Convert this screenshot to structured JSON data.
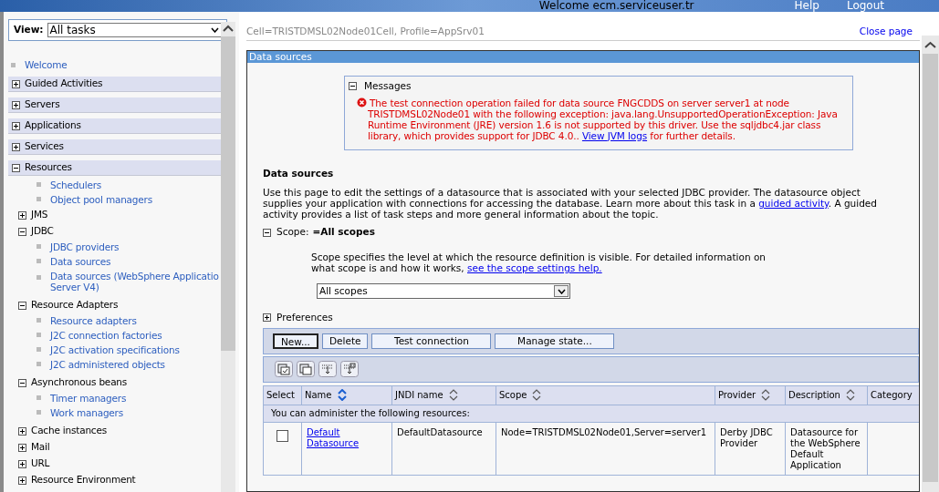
{
  "header": {
    "welcome": "Welcome ecm.serviceuser.tr",
    "links": [
      "Help",
      "Logout"
    ]
  },
  "view": {
    "label": "View:",
    "value": "All tasks"
  },
  "nav": [
    {
      "kind": "link",
      "label": "Welcome"
    },
    {
      "kind": "section",
      "label": "Guided Activities",
      "expanded": false
    },
    {
      "kind": "section",
      "label": "Servers",
      "expanded": false
    },
    {
      "kind": "section",
      "label": "Applications",
      "expanded": false
    },
    {
      "kind": "section",
      "label": "Services",
      "expanded": false
    },
    {
      "kind": "section",
      "label": "Resources",
      "expanded": true,
      "children": [
        {
          "kind": "link",
          "lines": [
            "Schedulers"
          ]
        },
        {
          "kind": "link",
          "lines": [
            "Object pool managers"
          ]
        },
        {
          "kind": "group",
          "label": "JMS",
          "expanded": false
        },
        {
          "kind": "group",
          "label": "JDBC",
          "expanded": true,
          "children": [
            {
              "kind": "link",
              "lines": [
                "JDBC providers"
              ]
            },
            {
              "kind": "link",
              "lines": [
                "Data sources"
              ]
            },
            {
              "kind": "link",
              "lines": [
                "Data sources (WebSphere Applicatio",
                "Server V4)"
              ]
            }
          ]
        },
        {
          "kind": "group",
          "label": "Resource Adapters",
          "expanded": true,
          "children": [
            {
              "kind": "link",
              "lines": [
                "Resource adapters"
              ]
            },
            {
              "kind": "link",
              "lines": [
                "J2C connection factories"
              ]
            },
            {
              "kind": "link",
              "lines": [
                "J2C activation specifications"
              ]
            },
            {
              "kind": "link",
              "lines": [
                "J2C administered objects"
              ]
            }
          ]
        },
        {
          "kind": "group",
          "label": "Asynchronous beans",
          "expanded": true,
          "children": [
            {
              "kind": "link",
              "lines": [
                "Timer managers"
              ]
            },
            {
              "kind": "link",
              "lines": [
                "Work managers"
              ]
            }
          ]
        },
        {
          "kind": "group",
          "label": "Cache instances",
          "expanded": false
        },
        {
          "kind": "group",
          "label": "Mail",
          "expanded": false
        },
        {
          "kind": "group",
          "label": "URL",
          "expanded": false
        },
        {
          "kind": "group",
          "label": "Resource Environment",
          "expanded": false
        }
      ]
    }
  ],
  "breadcrumb": "Cell=TRISTDMSL02Node01Cell, Profile=AppSrv01",
  "close_link": "Close page",
  "panel_title": "Data sources",
  "messages": {
    "title": "Messages",
    "expanded": true,
    "text": "The test connection operation failed for data source FNGCDDS on server server1 at node TRISTDMSL02Node01 with the following exception: java.lang.UnsupportedOperationException: Java Runtime Environment (JRE) version 1.6 is not supported by this driver. Use the sqljdbc4.jar class library, which provides support for JDBC 4.0..",
    "link": "View JVM logs",
    "suffix": "for further details."
  },
  "heading": "Data sources",
  "description": {
    "text": "Use this page to edit the settings of a datasource that is associated with your selected JDBC provider. The datasource object supplies your application with connections for accessing the database. Learn more about this task in a",
    "link": "guided activity",
    "suffix": ". A guided activity provides a list of task steps and more general information about the topic."
  },
  "scope": {
    "label": "Scope:",
    "value": "=All scopes",
    "expanded": true,
    "help": "Scope specifies the level at which the resource definition is visible. For detailed information on what scope is and how it works,",
    "link": "see the scope settings help.",
    "select": "All scopes"
  },
  "preferences": {
    "label": "Preferences",
    "expanded": false
  },
  "buttons": [
    {
      "label": "New...",
      "focused": true
    },
    {
      "label": "Delete",
      "focused": false
    },
    {
      "label": "Test connection",
      "focused": false
    },
    {
      "label": "Manage state...",
      "focused": false
    }
  ],
  "table": {
    "columns": [
      {
        "label": "Select"
      },
      {
        "label": "Name",
        "sorted": true
      },
      {
        "label": "JNDI name",
        "sorted": false
      },
      {
        "label": "Scope",
        "sorted": false
      },
      {
        "label": "Provider",
        "sorted": false
      },
      {
        "label": "Description",
        "sorted": false
      },
      {
        "label": "Category"
      }
    ],
    "group_row": "You can administer the following resources:",
    "rows": [
      {
        "checked": false,
        "name": "Default Datasource",
        "jndi": "DefaultDatasource",
        "scope": "Node=TRISTDMSL02Node01,Server=server1",
        "provider": "Derby JDBC Provider",
        "description": "Datasource for the WebSphere Default Application"
      }
    ]
  }
}
